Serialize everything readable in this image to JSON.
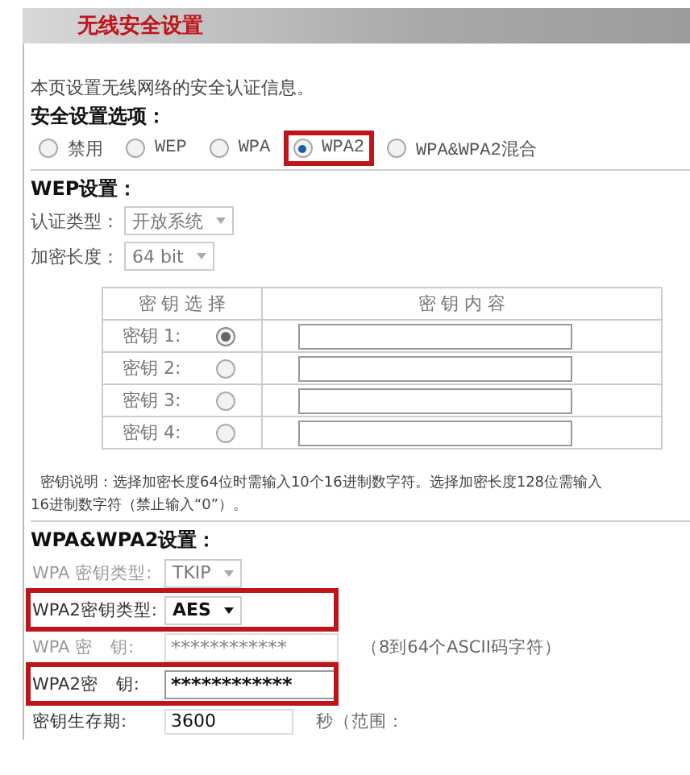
{
  "title": "无线安全设置",
  "intro": "本页设置无线网络的安全认证信息。",
  "options_label": "安全设置选项：",
  "security_options": [
    {
      "label": "禁用",
      "selected": false,
      "highlighted": false
    },
    {
      "label": "WEP",
      "selected": false,
      "highlighted": false
    },
    {
      "label": "WPA",
      "selected": false,
      "highlighted": false
    },
    {
      "label": "WPA2",
      "selected": true,
      "highlighted": true
    },
    {
      "label": "WPA&WPA2混合",
      "selected": false,
      "highlighted": false
    }
  ],
  "wep": {
    "heading": "WEP设置：",
    "disabled": true,
    "fields": [
      {
        "label": "认证类型：",
        "value": "开放系统"
      },
      {
        "label": "加密长度：",
        "value": "64 bit"
      }
    ],
    "columns": [
      "密 钥 选 择",
      "密 钥 内 容"
    ],
    "keys": [
      {
        "label": "密钥 1:",
        "selected": true
      },
      {
        "label": "密钥 2:",
        "selected": false
      },
      {
        "label": "密钥 3:",
        "selected": false
      },
      {
        "label": "密钥 4:",
        "selected": false
      }
    ],
    "note_lines": [
      "密钥说明：选择加密长度64位时需输入10个16进制数字符。选择加密长度128位需输入",
      "16进制数字符（禁止输入“0”）。"
    ]
  },
  "wpa": {
    "heading": "WPA&WPA2设置：",
    "rows": [
      {
        "kind": "select",
        "label": "WPA 密钥类型:",
        "value": "TKIP",
        "disabled": true,
        "highlighted": false
      },
      {
        "kind": "select",
        "label": "WPA2密钥类型:",
        "value": "AES",
        "disabled": false,
        "highlighted": true
      },
      {
        "kind": "password",
        "label": "WPA 密　钥:",
        "value": "************",
        "disabled": true,
        "highlighted": false,
        "hint": "（8到64个ASCII码字符）"
      },
      {
        "kind": "password",
        "label": "WPA2密　钥:",
        "value": "************",
        "disabled": false,
        "highlighted": true
      },
      {
        "kind": "text",
        "label": "密钥生存期:",
        "value": "3600",
        "disabled": false,
        "highlighted": false,
        "hint": "秒（范围："
      }
    ]
  }
}
